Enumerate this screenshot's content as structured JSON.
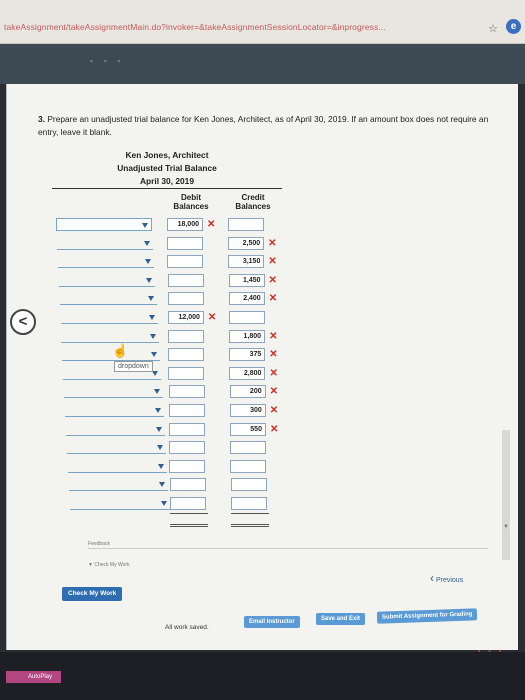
{
  "browser": {
    "url": "takeAssignment/takeAssignmentMain.do?invoker=&takeAssignmentSessionLocator=&inprogress..."
  },
  "question": {
    "number": "3.",
    "text": "Prepare an unadjusted trial balance for Ken Jones, Architect, as of April 30, 2019. If an amount box does not require an entry, leave it blank."
  },
  "table": {
    "company": "Ken Jones, Architect",
    "title": "Unadjusted Trial Balance",
    "date": "April 30, 2019",
    "debit_header": "Debit\nBalances",
    "credit_header": "Credit\nBalances",
    "rows": [
      {
        "debit": "18,000",
        "credit": "",
        "mark": "debit"
      },
      {
        "debit": "",
        "credit": "2,500",
        "mark": "credit"
      },
      {
        "debit": "",
        "credit": "3,150",
        "mark": "credit"
      },
      {
        "debit": "",
        "credit": "1,450",
        "mark": "credit"
      },
      {
        "debit": "",
        "credit": "2,400",
        "mark": "credit"
      },
      {
        "debit": "12,000",
        "credit": "",
        "mark": "debit"
      },
      {
        "debit": "",
        "credit": "1,800",
        "mark": "credit"
      },
      {
        "debit": "",
        "credit": "375",
        "mark": "credit"
      },
      {
        "debit": "",
        "credit": "2,800",
        "mark": "credit"
      },
      {
        "debit": "",
        "credit": "200",
        "mark": "credit"
      },
      {
        "debit": "",
        "credit": "300",
        "mark": "credit"
      },
      {
        "debit": "",
        "credit": "550",
        "mark": "credit"
      },
      {
        "debit": "",
        "credit": "",
        "mark": ""
      },
      {
        "debit": "",
        "credit": "",
        "mark": ""
      },
      {
        "debit": "",
        "credit": "",
        "mark": ""
      },
      {
        "debit": "",
        "credit": "",
        "mark": ""
      }
    ],
    "wrong_mark": "✕",
    "tooltip": "dropdown"
  },
  "feedback": {
    "label": "Feedback",
    "check_my_work_label": "▼ Check My Work"
  },
  "nav": {
    "previous": "Previous",
    "check_my_work": "Check My Work",
    "all_saved": "All work saved.",
    "email_instructor": "Email Instructor",
    "save_exit": "Save and Exit",
    "submit": "Submit Assignment for Grading"
  },
  "taskbar": {
    "app": "AutoPlay"
  },
  "colors": {
    "accent": "#2e6db0",
    "error": "#d12c1f"
  }
}
